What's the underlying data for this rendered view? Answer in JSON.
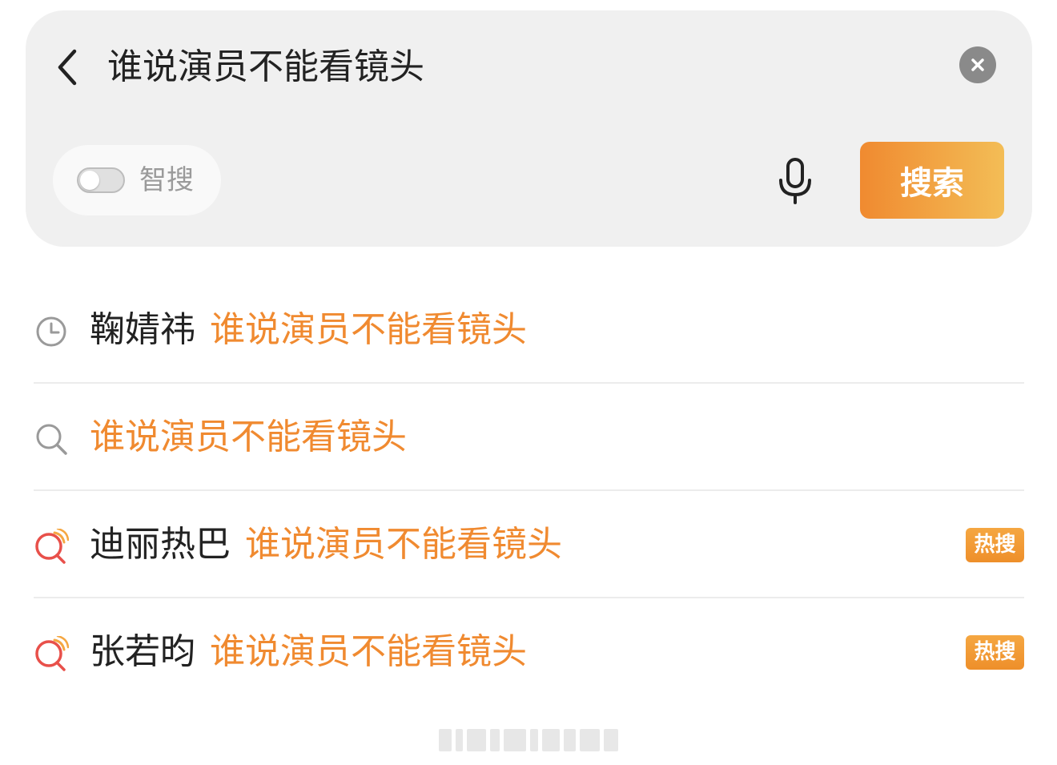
{
  "search_bar": {
    "query": "谁说演员不能看镜头",
    "back_icon": "chevron-left-icon",
    "clear_icon": "close-circle-icon",
    "smart_search": {
      "label": "智搜",
      "enabled": false
    },
    "mic_icon": "microphone-icon",
    "search_button_label": "搜索"
  },
  "suggestions": [
    {
      "icon": "history-clock-icon",
      "prefix": "鞠婧祎",
      "match": "谁说演员不能看镜头",
      "badge": ""
    },
    {
      "icon": "search-icon",
      "prefix": "",
      "match": "谁说演员不能看镜头",
      "badge": ""
    },
    {
      "icon": "hot-search-icon",
      "prefix": "迪丽热巴",
      "match": "谁说演员不能看镜头",
      "badge": "热搜"
    },
    {
      "icon": "hot-search-icon",
      "prefix": "张若昀",
      "match": "谁说演员不能看镜头",
      "badge": "热搜"
    }
  ],
  "colors": {
    "accent": "#f08a30",
    "accent_light": "#f3bd56",
    "panel_bg": "#f0f0f0",
    "text_primary": "#222222",
    "text_muted": "#9a9a9a",
    "hot_icon_red": "#e8504a"
  }
}
